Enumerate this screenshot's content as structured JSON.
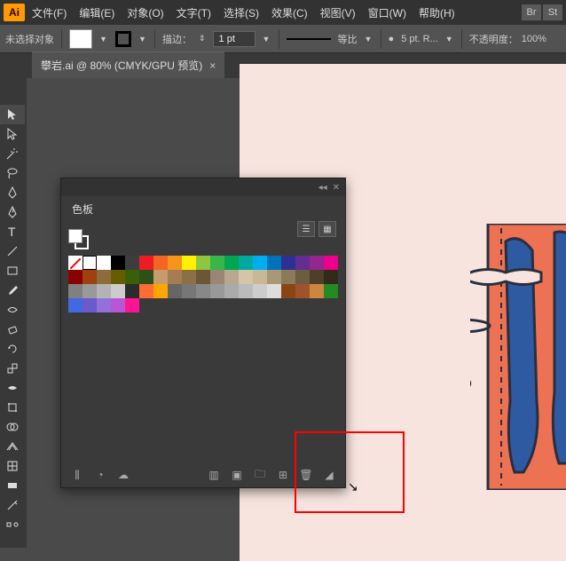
{
  "menu": {
    "file": "文件(F)",
    "edit": "编辑(E)",
    "object": "对象(O)",
    "type": "文字(T)",
    "select": "选择(S)",
    "effect": "效果(C)",
    "view": "视图(V)",
    "window": "窗口(W)",
    "help": "帮助(H)",
    "br": "Br",
    "st": "St"
  },
  "control": {
    "no_selection": "未选择对象",
    "stroke_label": "描边：",
    "stroke_value": "1 pt",
    "profile_label": "等比",
    "brush_label": "5 pt. R...",
    "opacity_label": "不透明度：",
    "opacity_value": "100%"
  },
  "tab": {
    "title": "攀岩.ai @ 80% (CMYK/GPU 预览)"
  },
  "panel": {
    "title": "色板",
    "swatches": [
      {
        "t": "none"
      },
      {
        "t": "reg"
      },
      {
        "c": "#ffffff"
      },
      {
        "c": "#000000"
      },
      {
        "c": "#3d3d3d"
      },
      {
        "c": "#ed1c24"
      },
      {
        "c": "#f26522"
      },
      {
        "c": "#f7941e"
      },
      {
        "c": "#fff200"
      },
      {
        "c": "#8dc63f"
      },
      {
        "c": "#39b54a"
      },
      {
        "c": "#00a651"
      },
      {
        "c": "#00a99d"
      },
      {
        "c": "#00aeef"
      },
      {
        "c": "#0072bc"
      },
      {
        "c": "#2e3192"
      },
      {
        "c": "#662d91"
      },
      {
        "c": "#92278f"
      },
      {
        "c": "#ec008c"
      },
      {
        "c": "#8b0000"
      },
      {
        "c": "#a0410d"
      },
      {
        "c": "#8a6d3b"
      },
      {
        "c": "#665c00"
      },
      {
        "c": "#3a5f0b"
      },
      {
        "c": "#2d5016"
      },
      {
        "c": "#c69c6d"
      },
      {
        "c": "#a67c52"
      },
      {
        "c": "#8b6f47"
      },
      {
        "c": "#6b5635"
      },
      {
        "c": "#998675"
      },
      {
        "c": "#b8a88f"
      },
      {
        "c": "#d4c5a9"
      },
      {
        "c": "#c9b896"
      },
      {
        "c": "#a89878"
      },
      {
        "c": "#8a7a5a"
      },
      {
        "c": "#6c5d3f"
      },
      {
        "c": "#4e4028"
      },
      {
        "c": "#332b1a"
      },
      {
        "c": "#808080"
      },
      {
        "c": "#999999"
      },
      {
        "c": "#b3b3b3"
      },
      {
        "c": "#cccccc"
      },
      {
        "c": "#2b2b2b"
      },
      {
        "c": "#ff6b35"
      },
      {
        "c": "#ffa500"
      },
      {
        "c": "#666666"
      },
      {
        "c": "#777777"
      },
      {
        "c": "#888888"
      },
      {
        "c": "#999999"
      },
      {
        "c": "#aaaaaa"
      },
      {
        "c": "#bbbbbb"
      },
      {
        "c": "#cccccc"
      },
      {
        "c": "#dddddd"
      },
      {
        "c": "#8b4513"
      },
      {
        "c": "#a0522d"
      },
      {
        "c": "#cd853f"
      },
      {
        "c": "#228b22"
      },
      {
        "c": "#4169e1"
      },
      {
        "c": "#6a5acd"
      },
      {
        "c": "#9370db"
      },
      {
        "c": "#ba55d3"
      },
      {
        "c": "#ff1493"
      }
    ]
  }
}
